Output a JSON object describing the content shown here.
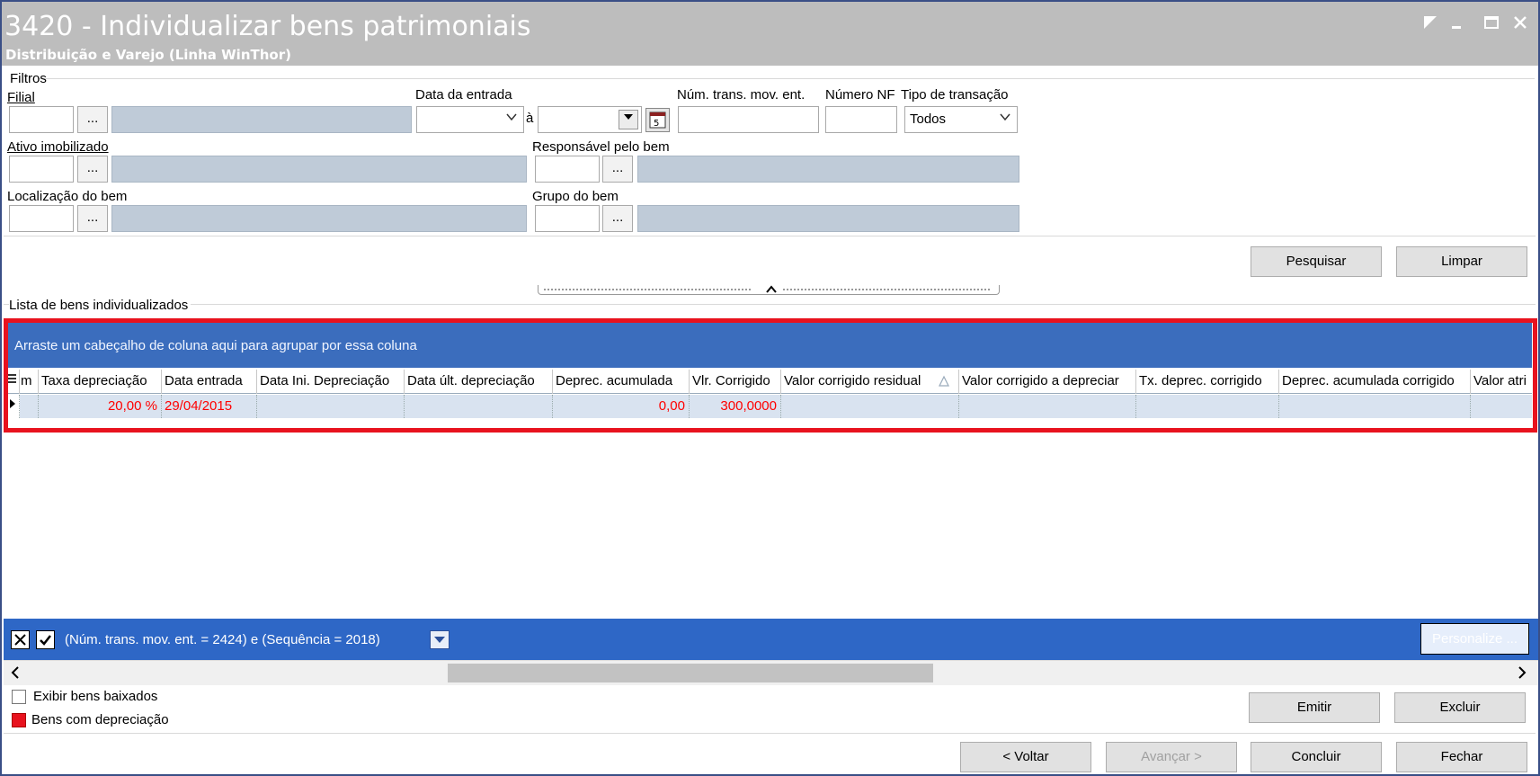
{
  "window": {
    "title": "3420 - Individualizar bens patrimoniais",
    "subtitle": "Distribuição e Varejo (Linha WinThor)"
  },
  "filters": {
    "group_label": "Filtros",
    "filial_label": "Filial",
    "data_entrada_label": "Data da entrada",
    "date_sep": "à",
    "num_trans_label": "Núm. trans. mov. ent.",
    "numero_nf_label": "Número NF",
    "tipo_transacao_label": "Tipo de transação",
    "tipo_transacao_value": "Todos",
    "ativo_label": "Ativo imobilizado",
    "responsavel_label": "Responsável pelo bem",
    "localizacao_label": "Localização do bem",
    "grupo_label": "Grupo do bem",
    "dots": "..."
  },
  "buttons": {
    "pesquisar": "Pesquisar",
    "limpar": "Limpar",
    "emitir": "Emitir",
    "excluir": "Excluir",
    "voltar": "< Voltar",
    "avancar": "Avançar >",
    "concluir": "Concluir",
    "fechar": "Fechar",
    "personalize": "Personalize ..."
  },
  "list": {
    "group_label": "Lista de bens individualizados",
    "group_hint": "Arraste um cabeçalho de coluna aqui para agrupar por essa coluna",
    "columns": [
      "m",
      "Taxa depreciação",
      "Data entrada",
      "Data Ini. Depreciação",
      "Data últ. depreciação",
      "Deprec. acumulada",
      "Vlr. Corrigido",
      "Valor corrigido residual",
      "Valor corrigido a depreciar",
      "Tx. deprec. corrigido",
      "Deprec. acumulada corrigido",
      "Valor atri"
    ],
    "row": {
      "taxa": "20,00 %",
      "data_entrada": "29/04/2015",
      "data_ini": "",
      "data_ult": "",
      "deprec_acum": "0,00",
      "vlr_corrigido": "300,0000"
    }
  },
  "filter_bar": {
    "text": "(Núm. trans. mov. ent. = 2424) e (Sequência = 2018)"
  },
  "legend": {
    "exibir_baixados": "Exibir bens baixados",
    "com_depreciacao": "Bens com depreciação"
  },
  "colors": {
    "accent_blue": "#2e67c6",
    "depreciation_red": "#e8121e",
    "titlebar": "#bdbdbd"
  }
}
